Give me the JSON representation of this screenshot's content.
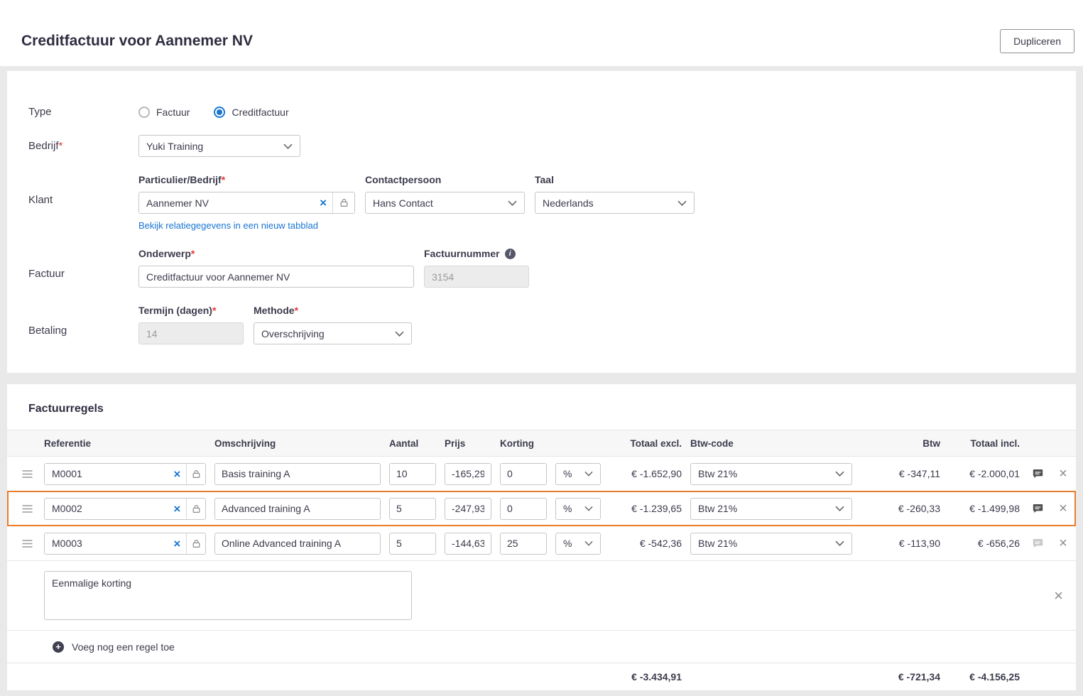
{
  "colors": {
    "accent_blue": "#1976d2",
    "highlight_orange": "#e87d2c",
    "required_red": "#e53935"
  },
  "required_mark": "*",
  "icons": {
    "clear": "×",
    "delete": "×",
    "info": "i",
    "plus": "+"
  },
  "header": {
    "title": "Creditfactuur voor Aannemer NV",
    "duplicate_button": "Dupliceren"
  },
  "form": {
    "type": {
      "label": "Type",
      "option_factuur": "Factuur",
      "option_creditfactuur": "Creditfactuur"
    },
    "bedrijf": {
      "label": "Bedrijf",
      "value": "Yuki Training"
    },
    "klant": {
      "label": "Klant",
      "particulier_label": "Particulier/Bedrijf",
      "particulier_value": "Aannemer NV",
      "contact_label": "Contactpersoon",
      "contact_value": "Hans Contact",
      "taal_label": "Taal",
      "taal_value": "Nederlands",
      "relatie_link": "Bekijk relatiegegevens in een nieuw tabblad"
    },
    "factuur": {
      "label": "Factuur",
      "onderwerp_label": "Onderwerp",
      "onderwerp_value": "Creditfactuur voor Aannemer NV",
      "nummer_label": "Factuurnummer",
      "nummer_value": "3154"
    },
    "betaling": {
      "label": "Betaling",
      "termijn_label": "Termijn (dagen)",
      "termijn_value": "14",
      "methode_label": "Methode",
      "methode_value": "Overschrijving"
    }
  },
  "lines": {
    "title": "Factuurregels",
    "headers": {
      "referentie": "Referentie",
      "omschrijving": "Omschrijving",
      "aantal": "Aantal",
      "prijs": "Prijs",
      "korting": "Korting",
      "totaal_excl": "Totaal excl.",
      "btw_code": "Btw-code",
      "btw": "Btw",
      "totaal_incl": "Totaal incl."
    },
    "rows": [
      {
        "referentie": "M0001",
        "omschrijving": "Basis training A",
        "aantal": "10",
        "prijs": "-165,29",
        "korting": "0",
        "korting_unit": "%",
        "totaal_excl": "€ -1.652,90",
        "btw_code": "Btw 21%",
        "btw": "€ -347,11",
        "totaal_incl": "€ -2.000,01"
      },
      {
        "referentie": "M0002",
        "omschrijving": "Advanced training A",
        "aantal": "5",
        "prijs": "-247,93",
        "korting": "0",
        "korting_unit": "%",
        "totaal_excl": "€ -1.239,65",
        "btw_code": "Btw 21%",
        "btw": "€ -260,33",
        "totaal_incl": "€ -1.499,98"
      },
      {
        "referentie": "M0003",
        "omschrijving": "Online Advanced training A",
        "aantal": "5",
        "prijs": "-144,63",
        "korting": "25",
        "korting_unit": "%",
        "totaal_excl": "€ -542,36",
        "btw_code": "Btw 21%",
        "btw": "€ -113,90",
        "totaal_incl": "€ -656,26"
      }
    ],
    "note_value": "Eenmalige korting",
    "add_row_label": "Voeg nog een regel toe",
    "totals": {
      "totaal_excl": "€ -3.434,91",
      "btw": "€ -721,34",
      "totaal_incl": "€ -4.156,25"
    }
  }
}
